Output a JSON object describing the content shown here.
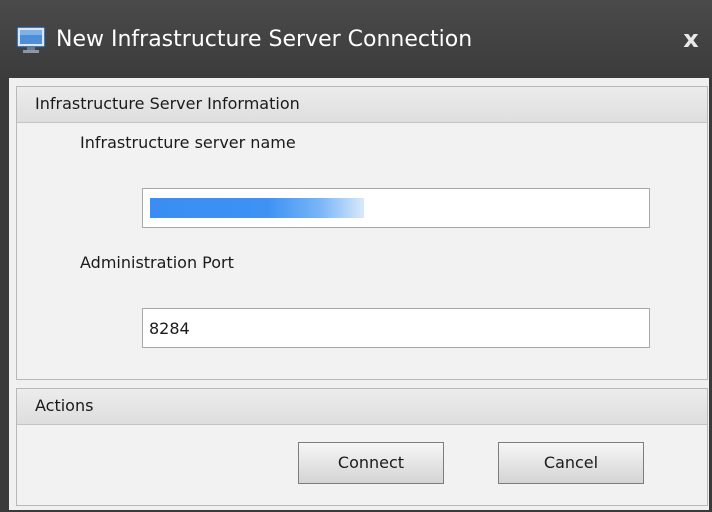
{
  "window": {
    "title": "New Infrastructure Server Connection",
    "close_label": "x"
  },
  "info_group": {
    "header": "Infrastructure Server Information",
    "server_name_label": "Infrastructure server name",
    "server_name_value": "",
    "port_label": "Administration Port",
    "port_value": "8284"
  },
  "actions_group": {
    "header": "Actions",
    "connect_label": "Connect",
    "cancel_label": "Cancel"
  },
  "icons": {
    "title": "monitor-icon",
    "close": "close-icon"
  }
}
